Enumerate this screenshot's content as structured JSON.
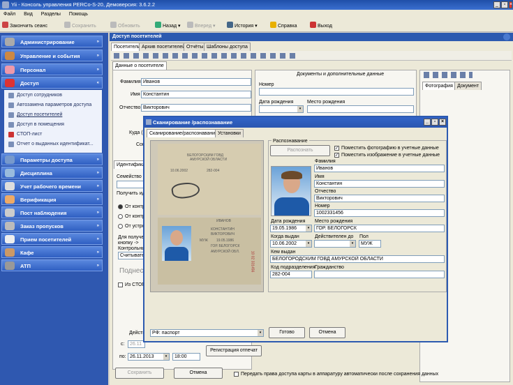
{
  "window": {
    "title": "Yii - Консоль управления PERCo-S-20, Демоверсия: 3.6.2.2"
  },
  "menu": [
    "Файл",
    "Вид",
    "Разделы",
    "Помощь"
  ],
  "toolbar": {
    "end_session": "Закончить сеанс",
    "save": "Сохранить",
    "refresh": "Обновить",
    "back": "Назад",
    "forward": "Вперед",
    "history": "История",
    "help": "Справка",
    "exit": "Выход"
  },
  "sidebar": {
    "groups_top": [
      "Администрирование",
      "Управление и события",
      "Персонал",
      "Доступ"
    ],
    "access_items": [
      "Доступ сотрудников",
      "Автозамена параметров доступа",
      "Доступ посетителей",
      "Доступ в помещения",
      "СТОП-лист",
      "Отчет о выданных идентификат..."
    ],
    "groups_bottom": [
      "Параметры доступа",
      "Дисциплина",
      "Учет рабочего времени",
      "Верификация",
      "Пост наблюдения",
      "Заказ пропусков",
      "Прием посетителей",
      "Кафе",
      "АТП"
    ]
  },
  "main": {
    "header": "Доступ посетителей",
    "tabs": [
      "Посетители",
      "Архив посетителей",
      "Отчёты",
      "Шаблоны доступа"
    ],
    "subtab": "Данные о посетителе",
    "labels": {
      "last_name": "Фамилия",
      "first_name": "Имя",
      "patronymic": "Отчество",
      "where": "Куда (п",
      "who": "Сопр",
      "identifier": "Идентификат",
      "family": "Семейство",
      "get_id": "Получить иде",
      "radio1": "От контр",
      "radio2": "От контр",
      "radio3": "От устрой",
      "receive": "Для получен",
      "button_arrow": "кнопку ->",
      "control": "Контрольный",
      "read_field": "Считывател",
      "bring": "Поднеси",
      "stop": "Из СТОП-л",
      "action": "Действ",
      "from": "с:",
      "to": "по:"
    },
    "values": {
      "last_name": "Иванов",
      "first_name": "Константин",
      "patronymic": "Викторович",
      "date_from": "26.11",
      "date_to": "26.11.2013",
      "time_to": "18:00"
    },
    "docs_header": "Документы и дополнительные данные",
    "docs": {
      "number": "Номер",
      "birth_date": "Дата рождения",
      "birth_place": "Место рождения"
    },
    "right_tabs": [
      "Фотография",
      "Документ"
    ],
    "registration": "Регистрация отпечат",
    "save_button": "Сохранить",
    "cancel_button": "Отмена",
    "transfer_checkbox": "Передать права доступа карты в аппаратуру автоматически после сохранения данных"
  },
  "dialog": {
    "title": "Сканирование /распознавание",
    "tabs": [
      "Сканирование/распознавание",
      "Установки"
    ],
    "recog_group": "Распознавание",
    "recognize_button": "Распознать",
    "cb_photo": "Поместить фотографию в учетные данные",
    "cb_image": "Поместить изображение в учетные данные",
    "fields": {
      "last_name": {
        "label": "Фамилия",
        "value": "Иванов"
      },
      "first_name": {
        "label": "Имя",
        "value": "Константин"
      },
      "patronymic": {
        "label": "Отчество",
        "value": "Викторович"
      },
      "number": {
        "label": "Номер",
        "value": "1002331456"
      },
      "birth_date": {
        "label": "Дата рождения",
        "value": "19.05.1986"
      },
      "birth_place": {
        "label": "Место рождения",
        "value": "ГОР. БЕЛОГОРСК"
      },
      "issued": {
        "label": "Когда выдан",
        "value": "10.06.2002"
      },
      "valid_to": {
        "label": "Действителен до",
        "value": ""
      },
      "sex": {
        "label": "Пол",
        "value": "МУЖ"
      },
      "issued_by": {
        "label": "Кем выдан",
        "value": "БЕЛОГОРОДСКИМ ГОВД АМУРСКОЙ ОБЛАСТИ"
      },
      "division": {
        "label": "Код подразделения",
        "value": "282-004"
      },
      "citizenship": {
        "label": "Гражданство",
        "value": ""
      }
    },
    "scan_text": {
      "auth": "БЕЛОГОРСКИМ ГОВД",
      "region": "АМУРСКОЙ ОБЛАСТИ",
      "issue_date": "10.06.2002",
      "code": "282-004",
      "surname": "ИВАНОВ",
      "name": "КОНСТАНТИН",
      "patr": "ВИКТОРОВИЧ",
      "sex": "МУЖ",
      "birth": "19.05.1986",
      "city": "ГОР. БЕЛОГОРСК",
      "region2": "АМУРСКОЙ ОБЛ.",
      "serial": "10 02 331456"
    },
    "doc_type": "РФ: паспорт",
    "ok_button": "Готово",
    "cancel_button": "Отмена"
  }
}
